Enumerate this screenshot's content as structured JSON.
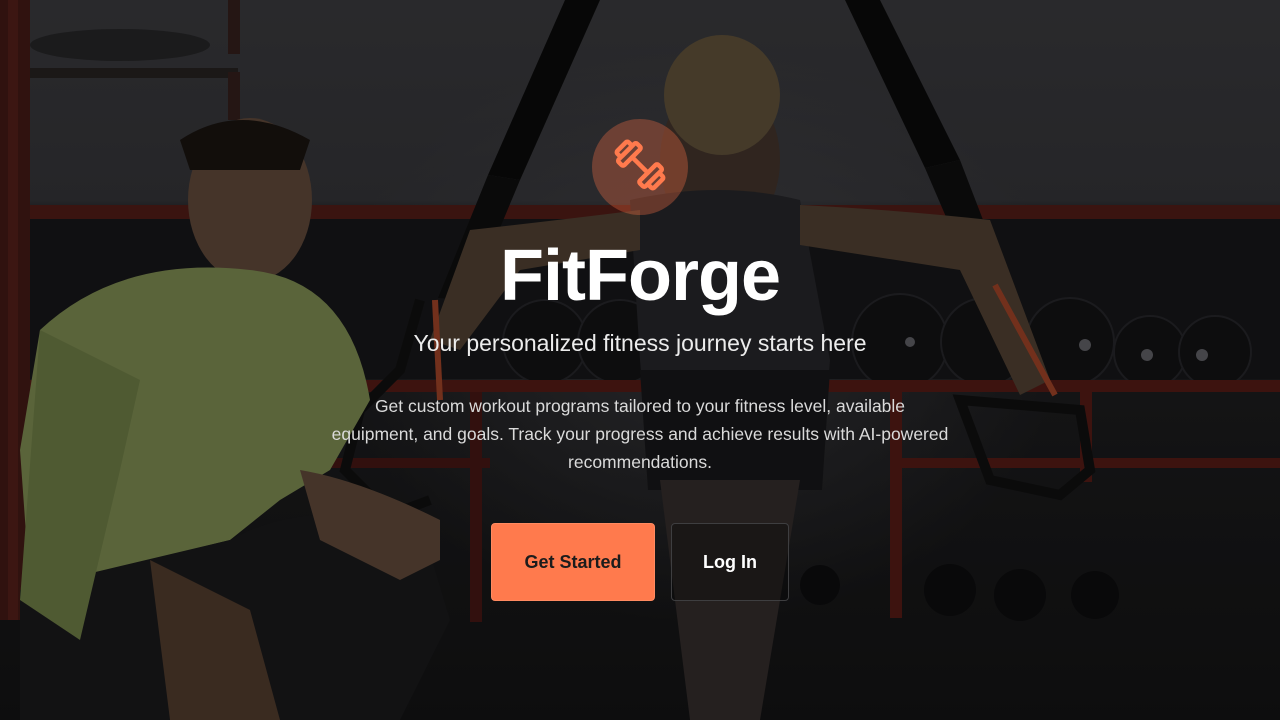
{
  "brand": {
    "logo_icon": "dumbbell-icon",
    "name": "FitForge",
    "accent_color": "#ff7a4d"
  },
  "hero": {
    "tagline": "Your personalized fitness journey starts here",
    "description": "Get custom workout programs tailored to your fitness level, available equipment, and goals. Track your progress and achieve results with AI-powered recommendations."
  },
  "actions": {
    "get_started_label": "Get Started",
    "login_label": "Log In"
  }
}
